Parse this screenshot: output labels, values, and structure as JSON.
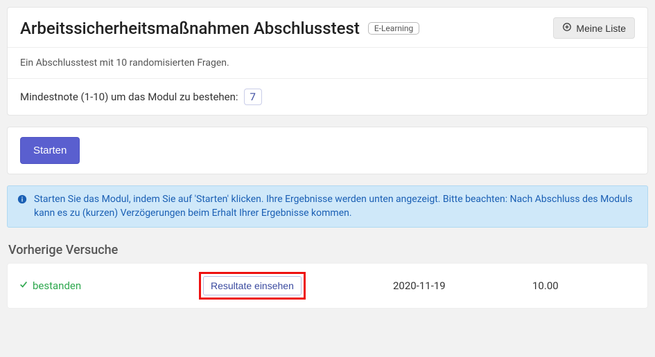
{
  "header": {
    "title": "Arbeitssicherheitsmaßnahmen Abschlusstest",
    "type_tag": "E-Learning",
    "my_list_label": "Meine Liste"
  },
  "description": "Ein Abschlusstest mit 10 randomisierten Fragen.",
  "min_score": {
    "label": "Mindestnote (1-10) um das Modul zu bestehen:",
    "value": "7"
  },
  "actions": {
    "start_label": "Starten"
  },
  "info": {
    "message": "Starten Sie das Modul, indem Sie auf 'Starten' klicken. Ihre Ergebnisse werden unten angezeigt. Bitte beachten: Nach Abschluss des Moduls kann es zu (kurzen) Verzögerungen beim Erhalt Ihrer Ergebnisse kommen."
  },
  "previous_attempts": {
    "heading": "Vorherige Versuche",
    "rows": [
      {
        "status": "bestanden",
        "view_results_label": "Resultate einsehen",
        "date": "2020-11-19",
        "score": "10.00"
      }
    ]
  }
}
